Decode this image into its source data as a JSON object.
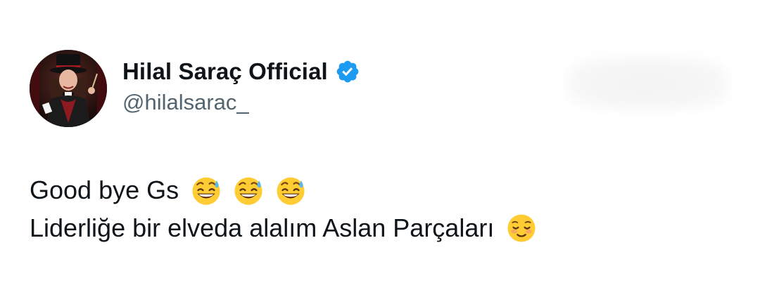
{
  "author": {
    "display_name": "Hilal Saraç Official",
    "handle": "@hilalsarac_",
    "verified": true,
    "avatar_icon": "avatar-magician-woman",
    "verified_color": "#1d9bf0"
  },
  "tweet": {
    "line1_text": "Good bye Gs",
    "line1_emojis": [
      "grinning-sweat-emoji",
      "grinning-sweat-emoji",
      "grinning-sweat-emoji"
    ],
    "line2_text": "Liderliğe bir elveda alalım Aslan Parçaları",
    "line2_emojis": [
      "smiling-blush-emoji"
    ]
  },
  "colors": {
    "text": "#0f1419",
    "secondary": "#536471",
    "background": "#ffffff"
  }
}
